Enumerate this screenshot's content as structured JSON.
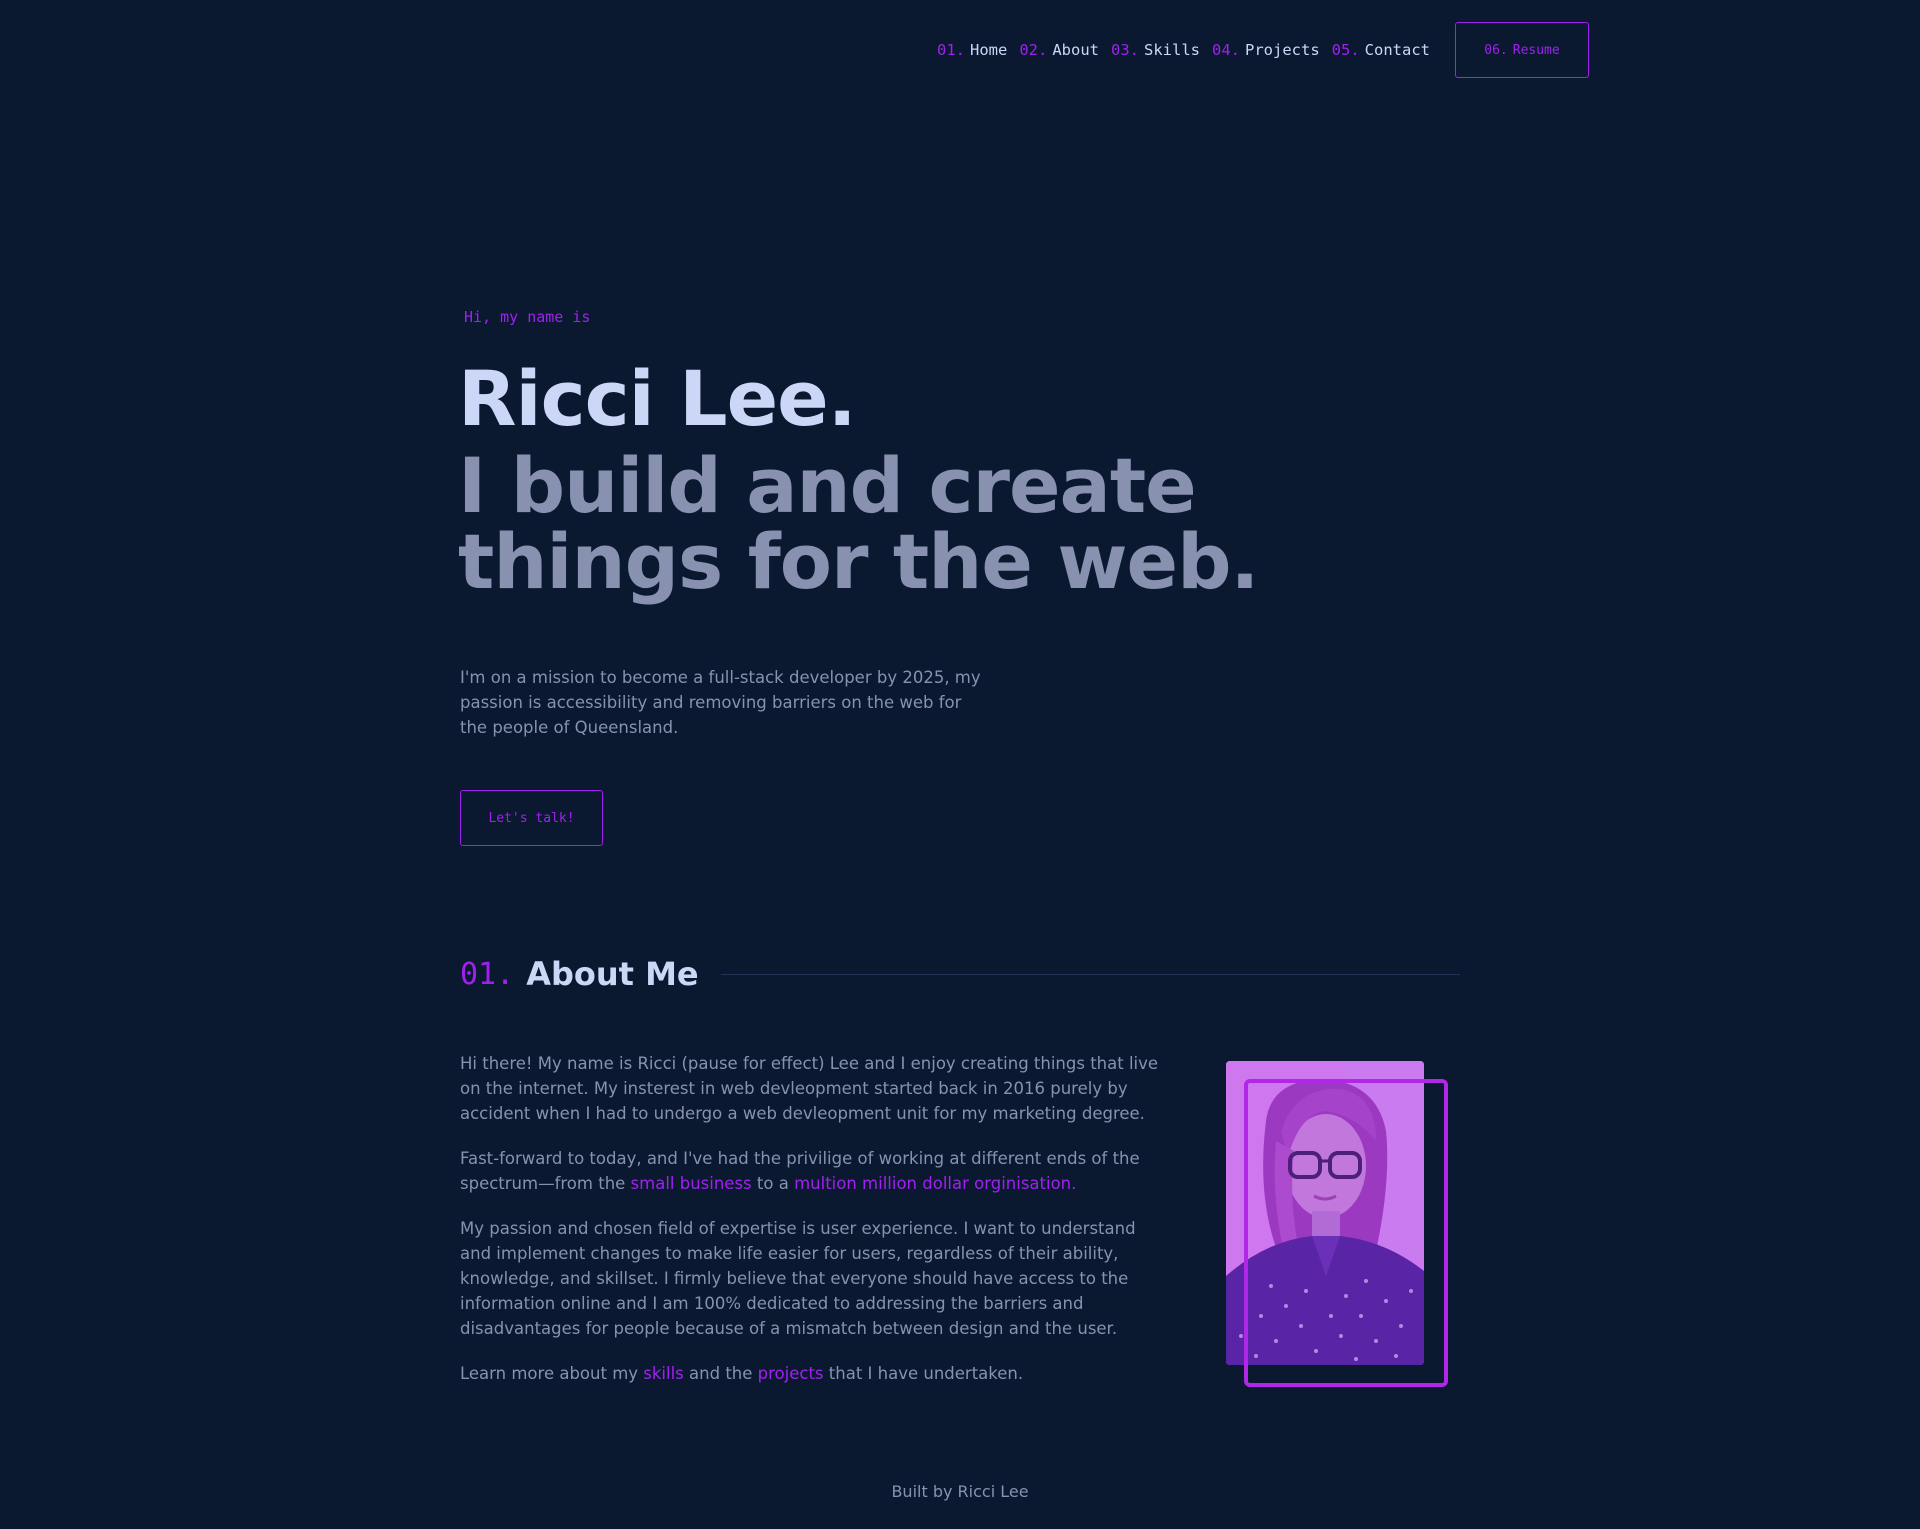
{
  "nav": {
    "links": [
      {
        "num": "01.",
        "label": "Home"
      },
      {
        "num": "02.",
        "label": "About"
      },
      {
        "num": "03.",
        "label": "Skills"
      },
      {
        "num": "04.",
        "label": "Projects"
      },
      {
        "num": "05.",
        "label": "Contact"
      }
    ],
    "resume": {
      "num": "06.",
      "label": "Resume"
    }
  },
  "hero": {
    "intro": "Hi, my name is",
    "name": "Ricci Lee.",
    "tagline": "I build and create things for the web.",
    "description": "I'm on a mission to become a full-stack developer by 2025, my passion is accessibility and removing barriers on the web for the people of Queensland.",
    "cta": "Let's talk!"
  },
  "about": {
    "number": "01.",
    "title": "About Me",
    "p1": "Hi there! My name is Ricci (pause for effect) Lee and I enjoy creating things that live on the internet. My insterest in web devleopment started back in 2016 purely by accident when I had to undergo a web devleopment unit for my marketing degree.",
    "p2_before": "Fast-forward to today, and I've had the privilige of working at different ends of the spectrum—from the ",
    "p2_link1": "small business",
    "p2_middle": " to a ",
    "p2_link2": "multion million dollar orginisation.",
    "p3": "My passion and chosen field of expertise is user experience. I want to understand and implement changes to make life easier for users, regardless of their ability, knowledge, and skillset. I firmly believe that everyone should have access to the information online and I am 100% dedicated to addressing the barriers and disadvantages for people because of a mismatch between design and the user.",
    "p4_before": "Learn more about my ",
    "p4_link1": "skills",
    "p4_middle": " and the ",
    "p4_link2": "projects",
    "p4_after": " that I have undertaken."
  },
  "footer": {
    "text": "Built by Ricci Lee"
  },
  "colors": {
    "background": "#0a192f",
    "accent": "#a020f0",
    "heading": "#ccd6f6",
    "body": "#8892b0"
  }
}
